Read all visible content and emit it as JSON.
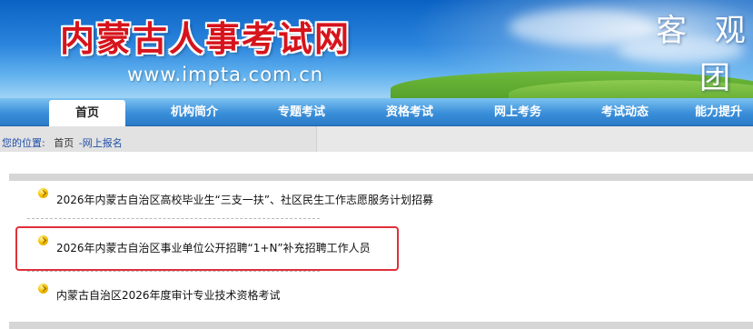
{
  "header": {
    "site_title": "内蒙古人事考试网",
    "site_url": "www.impta.com.cn",
    "slogan_line1": "客 观 公",
    "slogan_line2": "团 结"
  },
  "nav": {
    "items": [
      {
        "label": "首页",
        "active": true
      },
      {
        "label": "机构简介"
      },
      {
        "label": "专题考试"
      },
      {
        "label": "资格考试"
      },
      {
        "label": "网上考务"
      },
      {
        "label": "考试动态"
      },
      {
        "label": "能力提升"
      }
    ]
  },
  "breadcrumb": {
    "label": "您的位置:",
    "home": "首页",
    "current": "-网上报名"
  },
  "list": {
    "items": [
      {
        "title": "2026年内蒙古自治区高校毕业生“三支一扶”、社区民生工作志愿服务计划招募"
      },
      {
        "title": "2026年内蒙古自治区事业单位公开招聘“1+N”补充招聘工作人员",
        "highlighted": true
      },
      {
        "title": "内蒙古自治区2026年度审计专业技术资格考试"
      }
    ]
  },
  "colors": {
    "banner_blue": "#2a84dc",
    "title_red": "#d6141c",
    "highlight_red": "#e0303a",
    "link_blue": "#1f4ea8"
  }
}
